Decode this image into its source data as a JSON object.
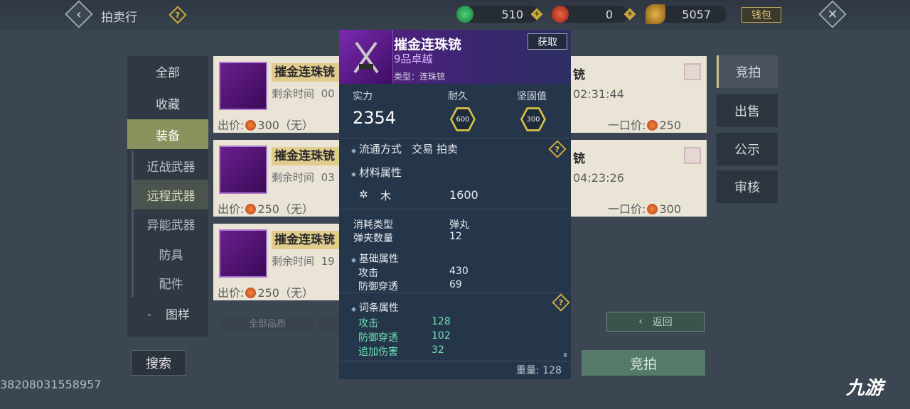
{
  "header": {
    "title": "拍卖行",
    "currencies": [
      {
        "icon": "jade-icon",
        "value": "510"
      },
      {
        "icon": "ruby-icon",
        "value": "0"
      },
      {
        "icon": "gold-leaf-icon",
        "value": "5057"
      }
    ],
    "wallet_label": "钱包"
  },
  "left_nav": [
    {
      "label": "全部",
      "sub": false
    },
    {
      "label": "收藏",
      "sub": false
    },
    {
      "label": "装备",
      "sub": false,
      "active": true
    },
    {
      "label": "近战武器",
      "sub": true
    },
    {
      "label": "远程武器",
      "sub": true,
      "active": true
    },
    {
      "label": "异能武器",
      "sub": true
    },
    {
      "label": "防具",
      "sub": true
    },
    {
      "label": "配件",
      "sub": true
    },
    {
      "label": "图样",
      "sub": false,
      "caret": "⌄"
    }
  ],
  "listings_left": [
    {
      "name": "摧金连珠铳",
      "remain_label": "剩余时间",
      "remain_value": "00",
      "price_label": "出价:",
      "price": "300（无）"
    },
    {
      "name": "摧金连珠铳",
      "remain_label": "剩余时间",
      "remain_value": "03",
      "price_label": "出价:",
      "price": "250（无）"
    },
    {
      "name": "摧金连珠铳",
      "remain_label": "剩余时间",
      "remain_value": "19",
      "price_label": "出价:",
      "price": "250（无）"
    }
  ],
  "listings_right": [
    {
      "name": "铳",
      "time": "02:31:44",
      "buyout_label": "一口价:",
      "buyout": "250"
    },
    {
      "name": "铳",
      "time": "04:23:26",
      "buyout_label": "一口价:",
      "buyout": "300"
    }
  ],
  "right_tabs": [
    "竞拍",
    "出售",
    "公示",
    "审核"
  ],
  "filter_quality": "全部品质",
  "buttons": {
    "search": "搜索",
    "bid": "竞拍",
    "back": "返回"
  },
  "footer_id": "38208031558957",
  "watermark": "九游",
  "tooltip": {
    "name": "摧金连珠铳",
    "grade": "9品卓越",
    "type": "类型：连珠铳",
    "get_label": "获取",
    "power_label": "实力",
    "power": "2354",
    "durability_label": "耐久",
    "durability": "600",
    "solidity_label": "坚固值",
    "solidity": "300",
    "trade_label": "流通方式",
    "trade_value": "交易 拍卖",
    "material_header": "材料属性",
    "material_name": "木",
    "material_value": "1600",
    "consume_label": "消耗类型",
    "consume_value": "弹丸",
    "clip_label": "弹夹数量",
    "clip_value": "12",
    "base_header": "基础属性",
    "base": [
      {
        "label": "攻击",
        "value": "430"
      },
      {
        "label": "防御穿透",
        "value": "69"
      }
    ],
    "affix_header": "词条属性",
    "affixes": [
      {
        "label": "攻击",
        "value": "128"
      },
      {
        "label": "防御穿透",
        "value": "102"
      },
      {
        "label": "追加伤害",
        "value": "32"
      }
    ],
    "weight": "重量: 128"
  },
  "colors": {
    "accent_gold": "#c9a83a",
    "epic_purple": "#5a1f86",
    "bid_green": "#557a6a"
  }
}
